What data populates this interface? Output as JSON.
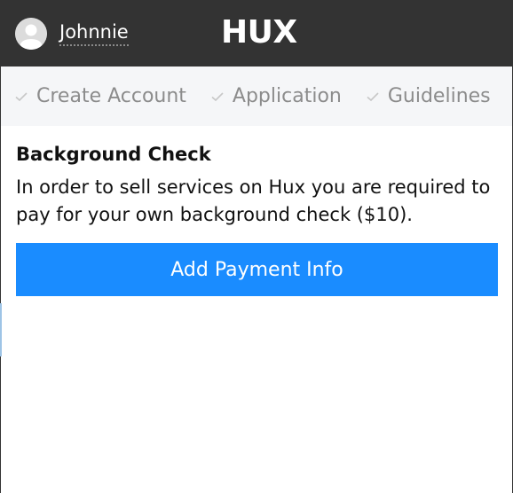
{
  "header": {
    "username": "Johnnie",
    "brand": "HUX",
    "avatar_icon": "user-avatar-icon"
  },
  "steps": [
    {
      "label": "Create Account",
      "icon": "check-icon"
    },
    {
      "label": "Application",
      "icon": "check-icon"
    },
    {
      "label": "Guidelines",
      "icon": "check-icon"
    }
  ],
  "main": {
    "title": "Background Check",
    "description": "In order to sell services on Hux you are required to pay for your own background check ($10).",
    "button_label": "Add Payment Info"
  },
  "colors": {
    "header_bg": "#333333",
    "steps_bg": "#f5f6f8",
    "accent": "#1a8cff"
  }
}
